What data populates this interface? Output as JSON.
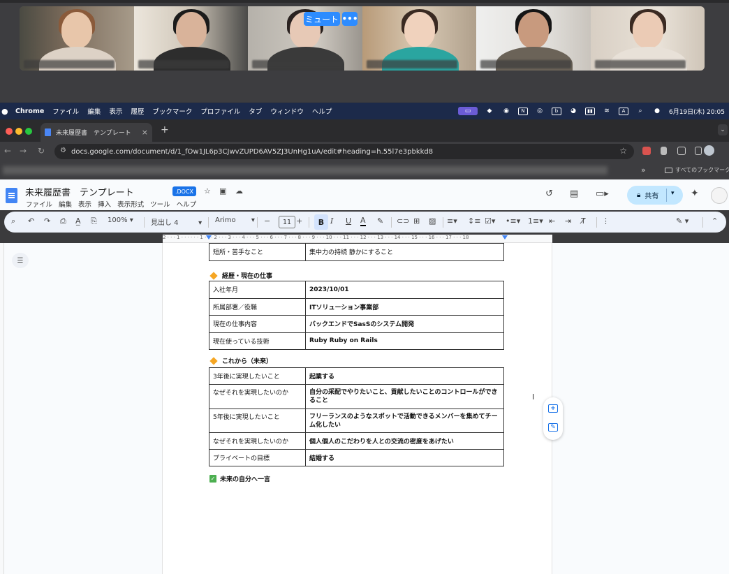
{
  "meeting": {
    "mute_label": "ミュート",
    "more_label": "•••"
  },
  "mac_menubar": {
    "app": "Chrome",
    "items": [
      "ファイル",
      "編集",
      "表示",
      "履歴",
      "ブックマーク",
      "プロファイル",
      "タブ",
      "ウィンドウ",
      "ヘルプ"
    ],
    "date_time": "6月19日(木) 20:05",
    "input_indicator": "A"
  },
  "browser": {
    "tab_title": "未来履歴書　テンプレート",
    "tab_close": "×",
    "new_tab": "+",
    "url": "docs.google.com/document/d/1_fOw1JL6p3CJwvZUPD6AV5ZJ3UnHg1uA/edit#heading=h.55l7e3pbkkd8",
    "bookmarks_more": "»",
    "all_bookmarks": "すべてのブックマーク"
  },
  "docs": {
    "title": "未来履歴書　テンプレート",
    "badge": ".DOCX",
    "menu": [
      "ファイル",
      "編集",
      "表示",
      "挿入",
      "表示形式",
      "ツール",
      "ヘルプ"
    ],
    "share_label": "共有",
    "zoom": "100%",
    "style": "見出し 4",
    "font": "Arimo",
    "font_size": "11",
    "ruler_numbers": "2 · · · 1 · · · · · · 1 · · · 2 · · · 3 · · · 4 · · · 5 · · · 6 · · · 7 · · · 8 · · · 9 · · · 10 · · · 11 · · · 12 · · · 13 · · · 14 · · · 15 · · · 16 · · · 17 · · · 18"
  },
  "document": {
    "top_table": [
      {
        "k": "短所・苦手なこと",
        "v": "集中力の持続 静かにすること"
      }
    ],
    "section1_title": "経歴・現在の仕事",
    "section1_table": [
      {
        "k": "入社年月",
        "v": "2023/10/01"
      },
      {
        "k": "所属部署／役職",
        "v": "ITソリューション事業部"
      },
      {
        "k": "現在の仕事内容",
        "v": "バックエンドでSasSのシステム開発"
      },
      {
        "k": "現在使っている技術",
        "v": "Ruby Ruby on Rails"
      }
    ],
    "section2_title": "これから（未来）",
    "section2_table": [
      {
        "k": "3年後に実現したいこと",
        "v": "起業する"
      },
      {
        "k": "なぜそれを実現したいのか",
        "v": "自分の采配でやりたいこと、貢献したいことのコントロールができること"
      },
      {
        "k": "5年後に実現したいこと",
        "v": "フリーランスのようなスポットで活動できるメンバーを集めてチーム化したい"
      },
      {
        "k": "なぜそれを実現したいのか",
        "v": "個人個人のこだわりを人との交流の密度をあげたい"
      },
      {
        "k": "プライベートの目標",
        "v": "結婚する"
      }
    ],
    "section3_title": "未来の自分へ一言",
    "section3_check": "✓"
  }
}
